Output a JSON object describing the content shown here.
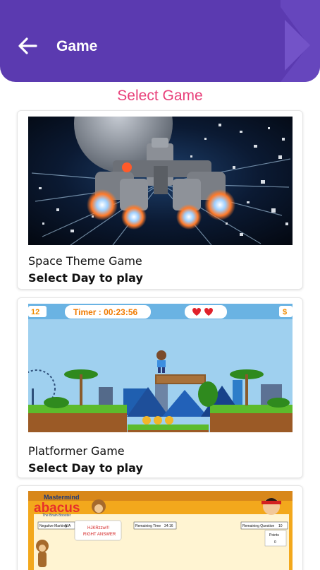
{
  "header": {
    "title": "Game"
  },
  "section_title": "Select Game",
  "games": [
    {
      "name": "Space Theme Game",
      "subtitle": "Select Day to play"
    },
    {
      "name": "Platformer Game",
      "subtitle": "Select Day to play",
      "thumb": {
        "score": "12",
        "timer": "Timer : 00:23:56",
        "right_corner": "$"
      }
    },
    {
      "thumb": {
        "brand_top": "Mastermind",
        "brand": "abacus",
        "brand_tag": "The Brain Booster",
        "negative_marking": "Negative Marking",
        "negative_value": "N/A",
        "remaining_time": "Remaining Time",
        "remaining_time_value": "34:16",
        "remaining_question": "Remaining Question",
        "remaining_question_value": "10",
        "bubble_line1": "HJKRzzw!!!",
        "bubble_line2": "RIGHT ANSWER",
        "points_label": "Points",
        "points_value": "0"
      }
    }
  ],
  "colors": {
    "header": "#5b3ab0",
    "accent_title": "#e8407a",
    "card_border": "#e6e6e6"
  }
}
